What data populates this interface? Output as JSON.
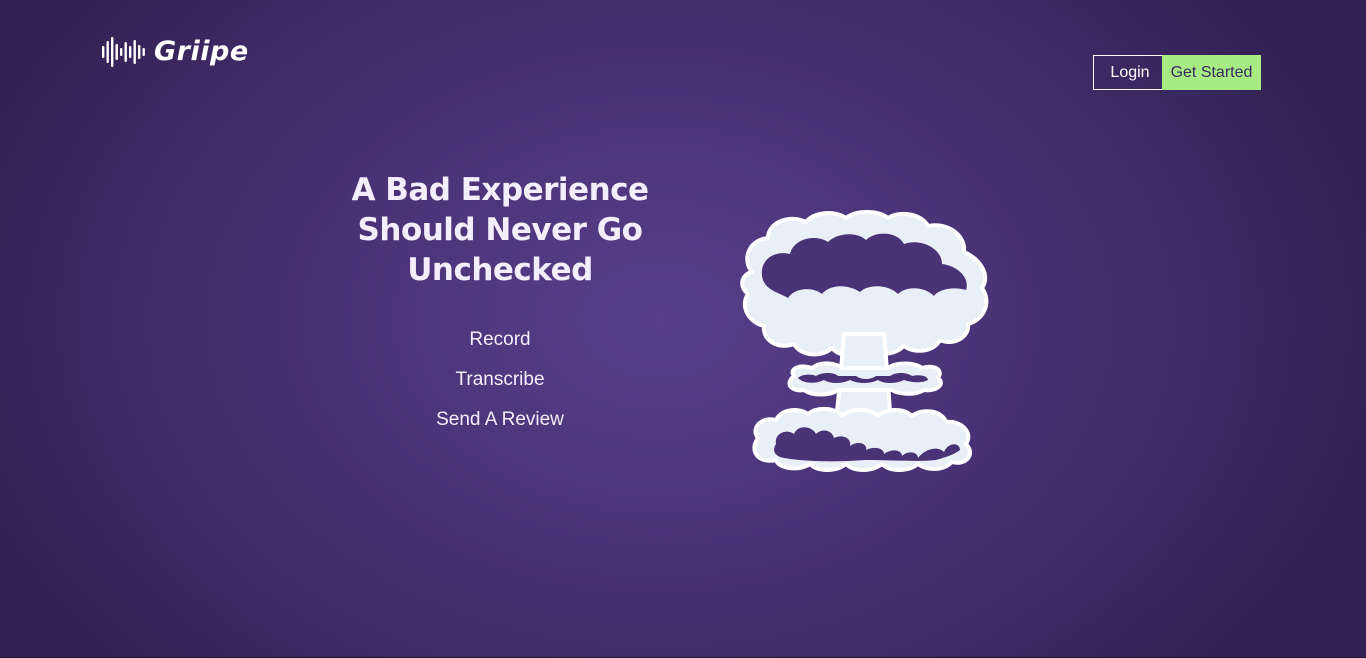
{
  "brand": {
    "name": "Griipe",
    "logo_icon": "sound-wave-icon"
  },
  "nav": {
    "login_label": "Login",
    "get_started_label": "Get Started"
  },
  "hero": {
    "headline_lines": [
      "A Bad Experience",
      "Should Never Go",
      "Unchecked"
    ],
    "features": [
      "Record",
      "Transcribe",
      "Send A Review"
    ],
    "illustration_icon": "mushroom-cloud-icon"
  },
  "colors": {
    "background": "#4a3277",
    "accent": "#a6ec82",
    "text": "#ffffff",
    "illustration_fill": "#e8eff7"
  }
}
